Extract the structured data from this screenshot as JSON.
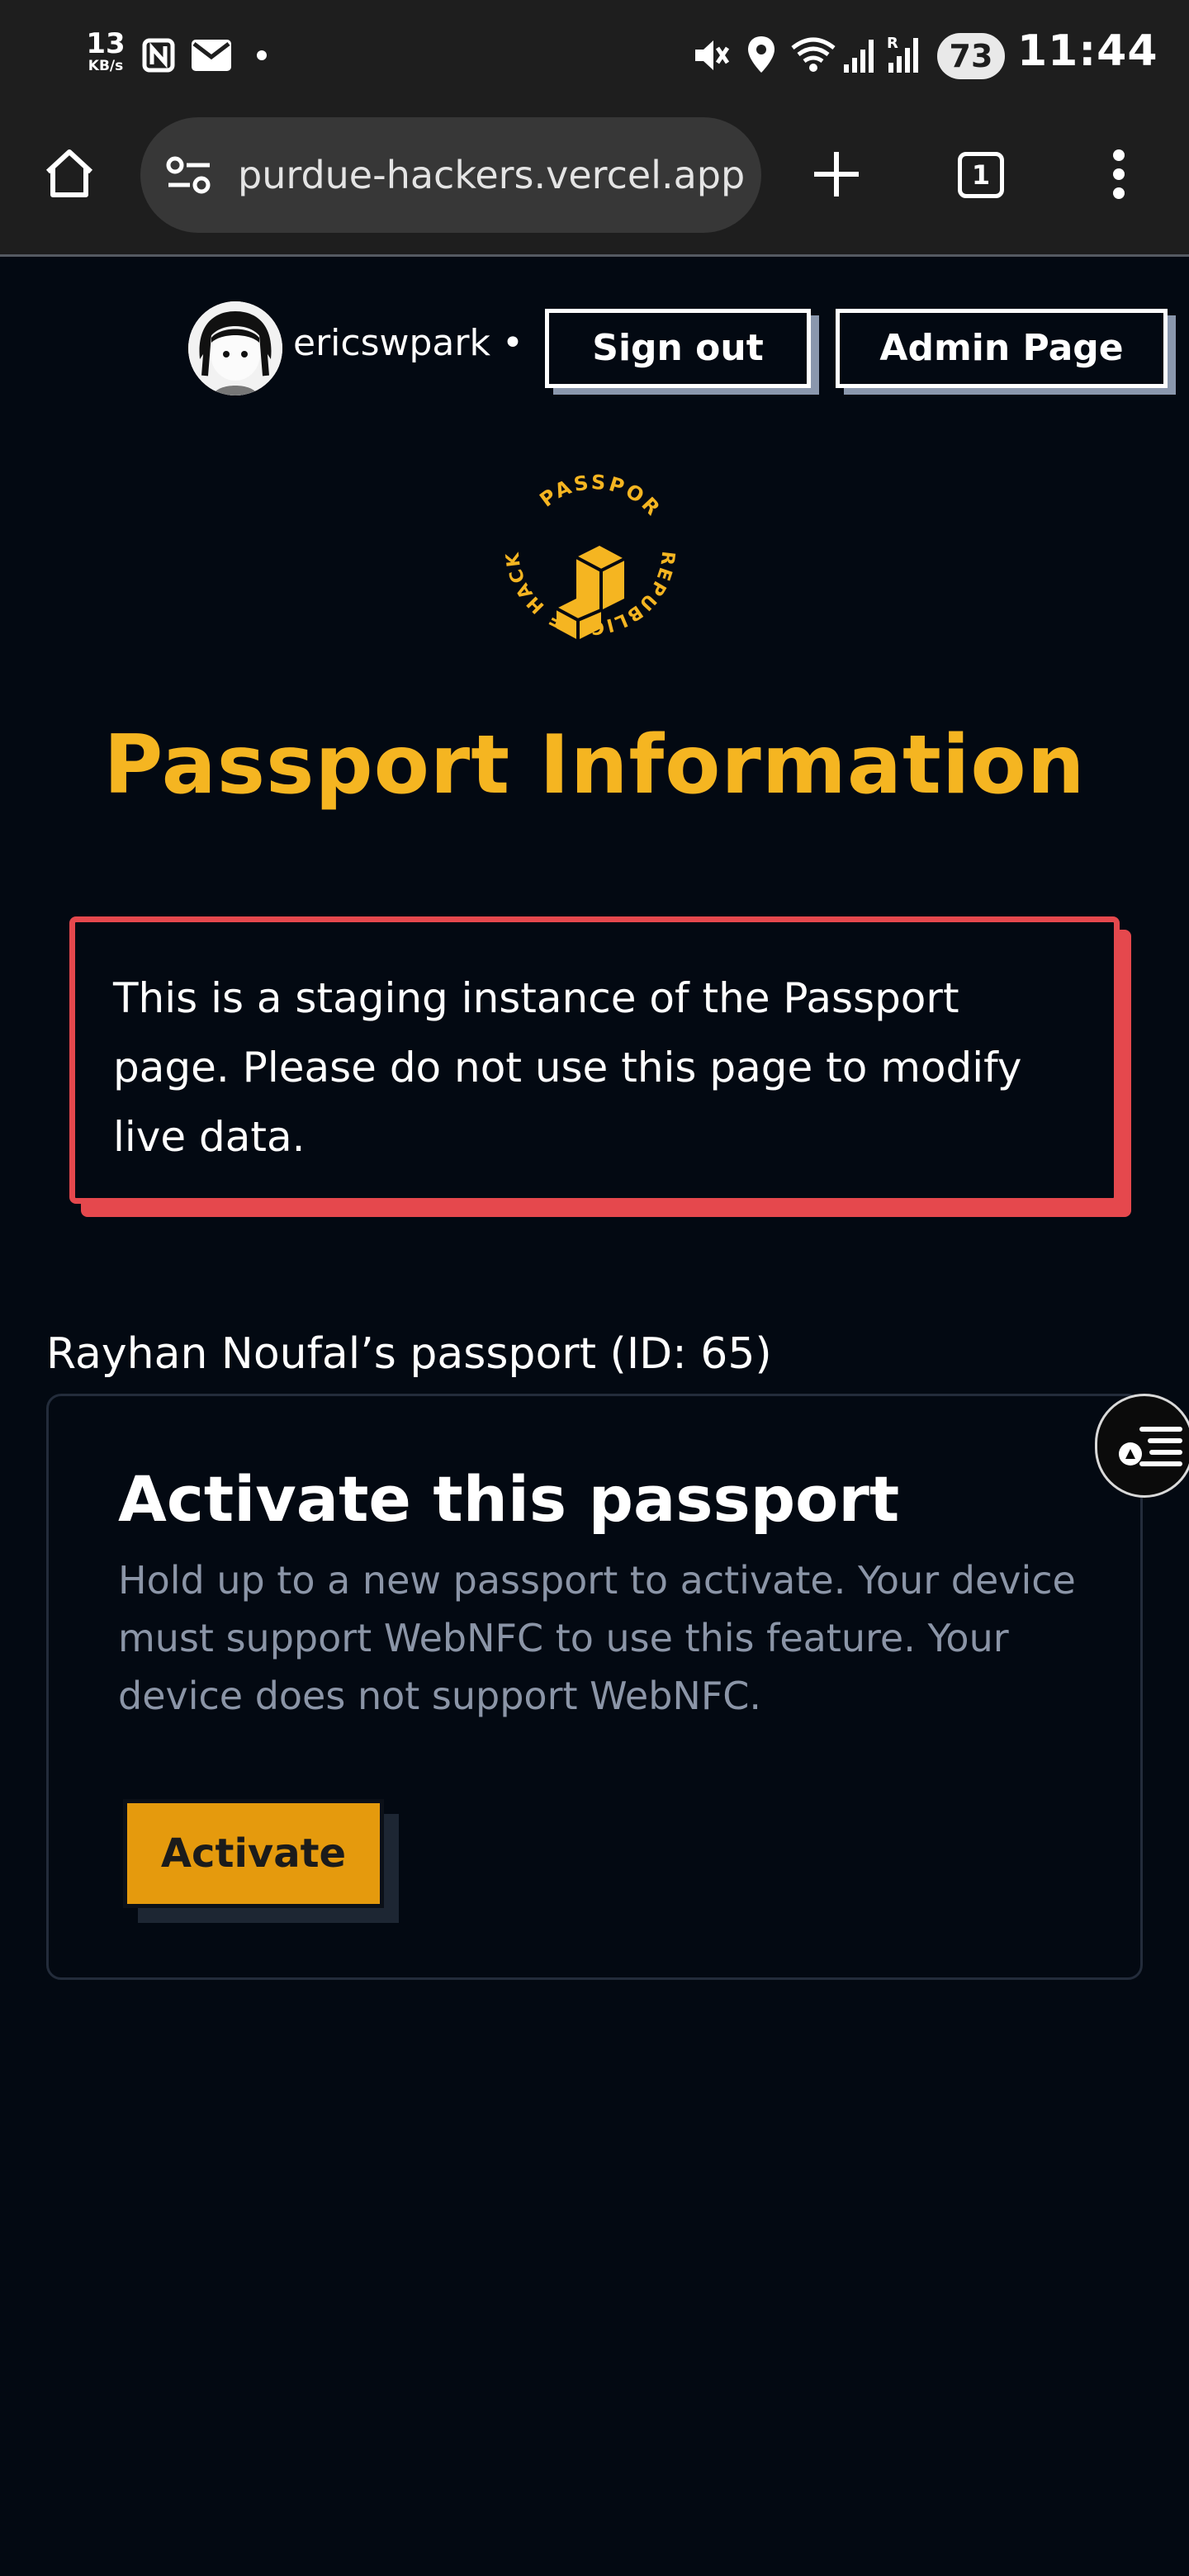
{
  "status_bar": {
    "net_speed_value": "13",
    "net_speed_unit": "KB/s",
    "battery": "73",
    "time": "11:44",
    "icons": [
      "nfc-icon",
      "mail-icon",
      "mute-icon",
      "location-icon",
      "wifi-icon",
      "signal-icon",
      "signal-r-icon"
    ]
  },
  "browser": {
    "url": "purdue-hackers.vercel.app",
    "tab_count": "1",
    "icons": [
      "home-icon",
      "site-settings-icon",
      "new-tab-icon",
      "tab-switcher-icon",
      "overflow-menu-icon"
    ]
  },
  "header": {
    "username": "ericswpark",
    "separator": "•",
    "sign_out_label": "Sign out",
    "admin_page_label": "Admin Page"
  },
  "logo": {
    "top_text": "PASSPORT",
    "right_text": "REPUBLIC OF HACKERLAND",
    "color": "#f5b521"
  },
  "page": {
    "title": "Passport Information",
    "warning": "This is a staging instance of the Passport page. Please do not use this page to modify live data.",
    "owner_line": "Rayhan Noufal’s passport (ID: 65)"
  },
  "card": {
    "title": "Activate this passport",
    "description": "Hold up to a new passport to activate. Your device must support WebNFC to use this feature. Your device does not support WebNFC.",
    "button_label": "Activate"
  },
  "colors": {
    "background": "#030912",
    "accent": "#f5b521",
    "warning": "#e5484d",
    "button": "#e59a0d"
  }
}
